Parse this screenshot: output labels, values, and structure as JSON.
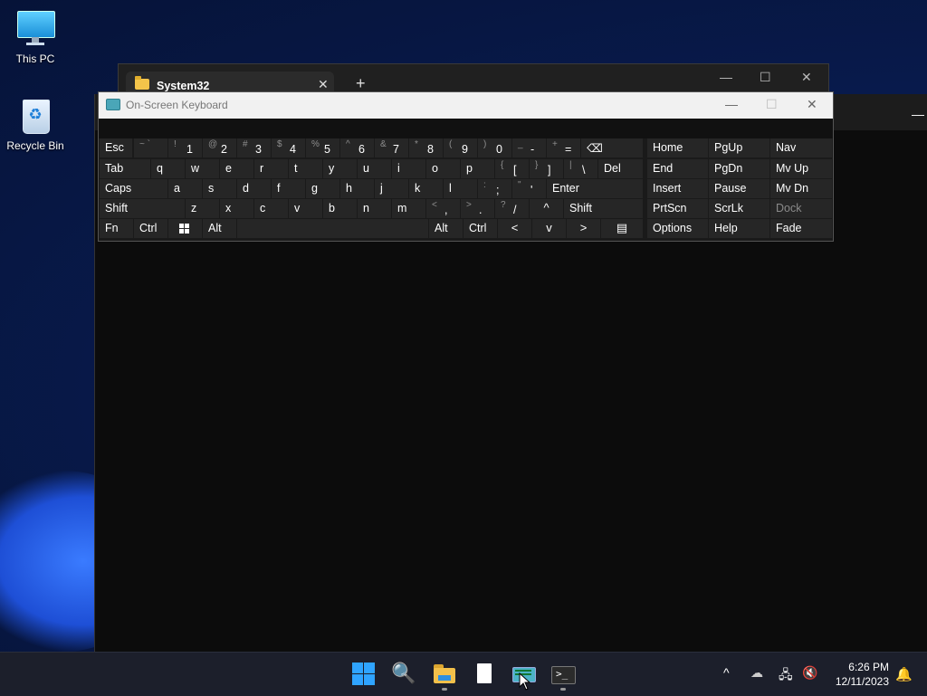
{
  "desktop": {
    "icons": [
      {
        "label": "This PC"
      },
      {
        "label": "Recycle Bin"
      }
    ]
  },
  "explorer": {
    "tab_title": "System32",
    "close_glyph": "✕",
    "new_tab_glyph": "+",
    "minimize_glyph": "—",
    "maximize_glyph": "☐",
    "window_close_glyph": "✕"
  },
  "terminal": {
    "minimize_glyph": "—"
  },
  "osk": {
    "title": "On-Screen Keyboard",
    "minimize_glyph": "—",
    "maximize_glyph": "☐",
    "close_glyph": "✕",
    "keys": {
      "esc": "Esc",
      "grave": {
        "shift": "~ `",
        "main": ""
      },
      "d1": {
        "shift": "!",
        "main": "1"
      },
      "d2": {
        "shift": "@",
        "main": "2"
      },
      "d3": {
        "shift": "#",
        "main": "3"
      },
      "d4": {
        "shift": "$",
        "main": "4"
      },
      "d5": {
        "shift": "%",
        "main": "5"
      },
      "d6": {
        "shift": "^",
        "main": "6"
      },
      "d7": {
        "shift": "&",
        "main": "7"
      },
      "d8": {
        "shift": "*",
        "main": "8"
      },
      "d9": {
        "shift": "(",
        "main": "9"
      },
      "d0": {
        "shift": ")",
        "main": "0"
      },
      "minus": {
        "shift": "_",
        "main": "-"
      },
      "equals": {
        "shift": "+",
        "main": "="
      },
      "backspace": "⌫",
      "tab": "Tab",
      "q": "q",
      "w": "w",
      "e": "e",
      "r": "r",
      "t": "t",
      "y": "y",
      "u": "u",
      "i": "i",
      "o": "o",
      "p": "p",
      "lbracket": {
        "shift": "{",
        "main": "["
      },
      "rbracket": {
        "shift": "}",
        "main": "]"
      },
      "backslash": {
        "shift": "|",
        "main": "\\"
      },
      "del": "Del",
      "caps": "Caps",
      "a": "a",
      "s": "s",
      "d": "d",
      "f": "f",
      "g": "g",
      "h": "h",
      "j": "j",
      "k": "k",
      "l": "l",
      "semicolon": {
        "shift": ":",
        "main": ";"
      },
      "quote": {
        "shift": "\"",
        "main": "'"
      },
      "enter": "Enter",
      "shift_l": "Shift",
      "z": "z",
      "x": "x",
      "c": "c",
      "v": "v",
      "b": "b",
      "n": "n",
      "m": "m",
      "comma": {
        "shift": "<",
        "main": ","
      },
      "period": {
        "shift": ">",
        "main": "."
      },
      "slash": {
        "shift": "?",
        "main": "/"
      },
      "up": "^",
      "shift_r": "Shift",
      "fn": "Fn",
      "ctrl_l": "Ctrl",
      "alt_l": "Alt",
      "alt_r": "Alt",
      "ctrl_r": "Ctrl",
      "left": "<",
      "down": "v",
      "right": ">",
      "menu": "▤",
      "home": "Home",
      "pgup": "PgUp",
      "nav": "Nav",
      "end": "End",
      "pgdn": "PgDn",
      "mvup": "Mv Up",
      "insert": "Insert",
      "pause": "Pause",
      "mvdn": "Mv Dn",
      "prtscn": "PrtScn",
      "scrlk": "ScrLk",
      "dock": "Dock",
      "options": "Options",
      "help": "Help",
      "fade": "Fade"
    }
  },
  "taskbar": {
    "clock_time": "6:26 PM",
    "clock_date": "12/11/2023",
    "search_glyph": "🔍",
    "prompt_glyph": ">_",
    "tray_chevron": "^",
    "tray_cloud": "☁",
    "tray_network": "🖧",
    "tray_volume": "🔇",
    "notification_glyph": "🔔"
  },
  "colors": {
    "accent": "#2fa4ff",
    "key_bg": "#262626",
    "osk_bg": "#1a1a1a"
  }
}
